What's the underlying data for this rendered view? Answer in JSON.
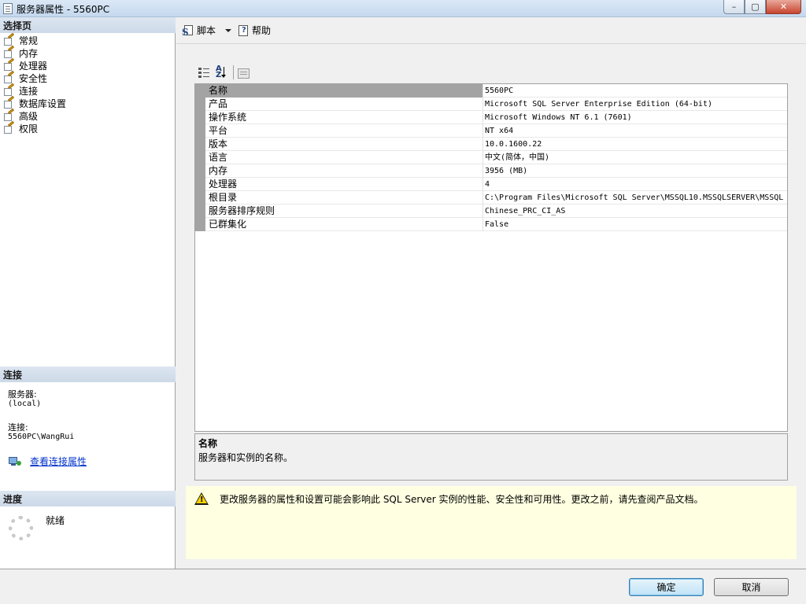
{
  "window": {
    "title": "服务器属性 - 5560PC",
    "minimize": "–",
    "maximize": "▢",
    "close": "✕"
  },
  "left": {
    "select_page_header": "选择页",
    "pages": [
      {
        "label": "常规"
      },
      {
        "label": "内存"
      },
      {
        "label": "处理器"
      },
      {
        "label": "安全性"
      },
      {
        "label": "连接"
      },
      {
        "label": "数据库设置"
      },
      {
        "label": "高级"
      },
      {
        "label": "权限"
      }
    ],
    "connection_header": "连接",
    "server_label": "服务器:",
    "server_value": "(local)",
    "connection_label": "连接:",
    "connection_value": "5560PC\\WangRui",
    "view_conn_props": "查看连接属性",
    "progress_header": "进度",
    "progress_status": "就绪"
  },
  "toolbar": {
    "script_label": "脚本",
    "help_label": "帮助"
  },
  "properties": [
    {
      "name": "名称",
      "value": "5560PC"
    },
    {
      "name": "产品",
      "value": "Microsoft SQL Server Enterprise Edition (64-bit)"
    },
    {
      "name": "操作系统",
      "value": "Microsoft Windows NT 6.1 (7601)"
    },
    {
      "name": "平台",
      "value": "NT x64"
    },
    {
      "name": "版本",
      "value": "10.0.1600.22"
    },
    {
      "name": "语言",
      "value": "中文(简体，中国)"
    },
    {
      "name": "内存",
      "value": "3956 (MB)"
    },
    {
      "name": "处理器",
      "value": "4"
    },
    {
      "name": "根目录",
      "value": "C:\\Program Files\\Microsoft SQL Server\\MSSQL10.MSSQLSERVER\\MSSQL"
    },
    {
      "name": "服务器排序规则",
      "value": "Chinese_PRC_CI_AS"
    },
    {
      "name": "已群集化",
      "value": "False"
    }
  ],
  "description": {
    "title": "名称",
    "text": "服务器和实例的名称。"
  },
  "warning": {
    "text": "更改服务器的属性和设置可能会影响此 SQL Server 实例的性能、安全性和可用性。更改之前，请先查阅产品文档。"
  },
  "buttons": {
    "ok": "确定",
    "cancel": "取消"
  }
}
